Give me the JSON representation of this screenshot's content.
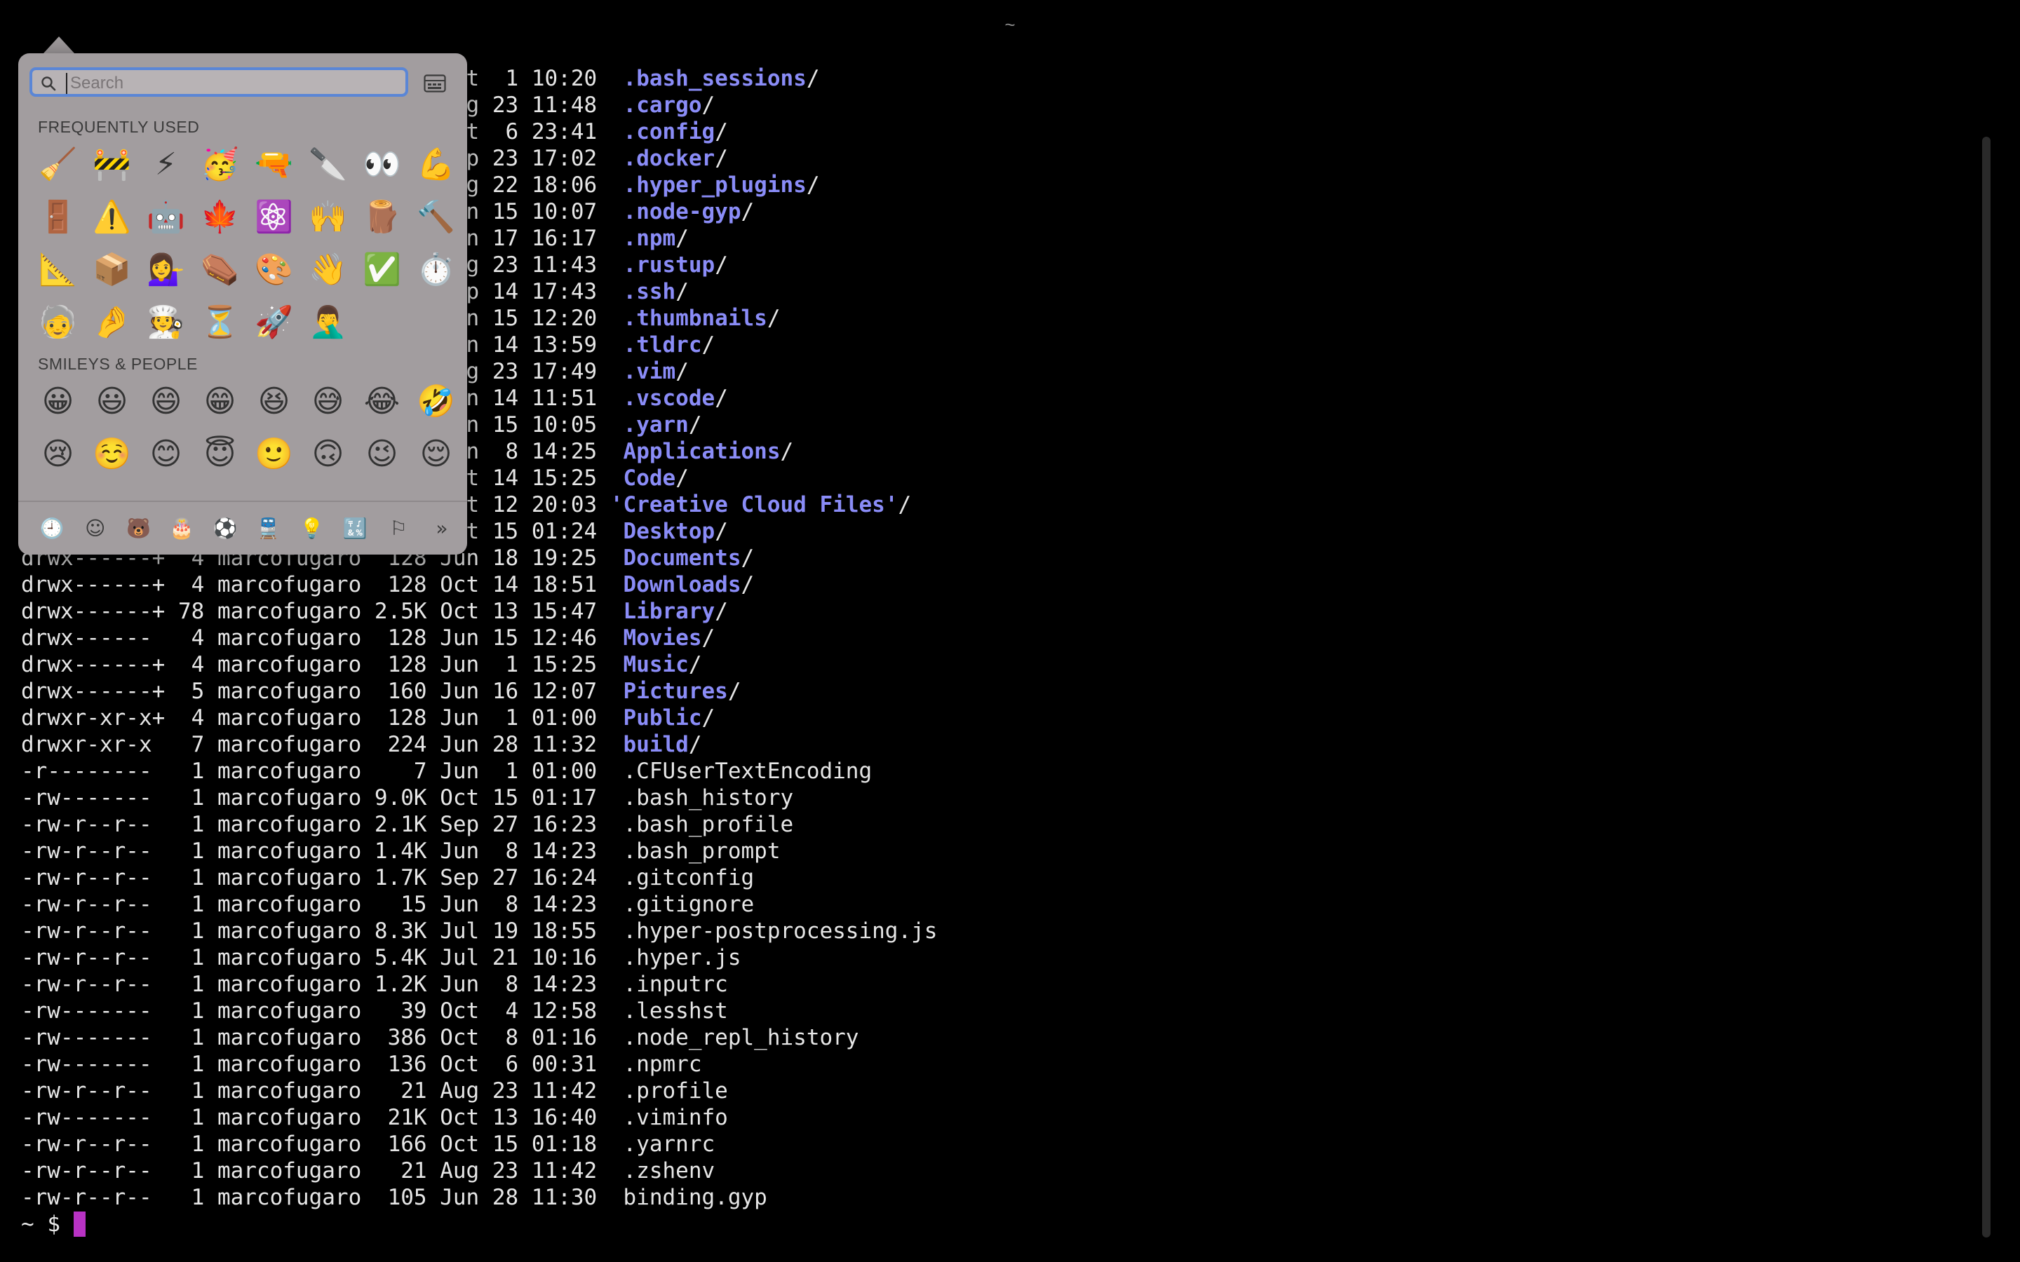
{
  "window": {
    "title": "~"
  },
  "terminal": {
    "lines": [
      [
        {
          "t": "drwx------+  4 marcofugaro  128 Oct  1 10:20  ",
          "c": "plain"
        },
        {
          "t": ".bash_sessions",
          "c": "dir"
        },
        {
          "t": "/",
          "c": "plain"
        }
      ],
      [
        {
          "t": "drwxr-xr-x   7 marcofugaro  224 Aug 23 11:48  ",
          "c": "plain"
        },
        {
          "t": ".cargo",
          "c": "dir"
        },
        {
          "t": "/",
          "c": "plain"
        }
      ],
      [
        {
          "t": "drwxr-xr-x   7 marcofugaro  224 Oct  6 23:41  ",
          "c": "plain"
        },
        {
          "t": ".config",
          "c": "dir"
        },
        {
          "t": "/",
          "c": "plain"
        }
      ],
      [
        {
          "t": "drwxr-xr-x   7 marcofugaro  224 Sep 23 17:02  ",
          "c": "plain"
        },
        {
          "t": ".docker",
          "c": "dir"
        },
        {
          "t": "/",
          "c": "plain"
        }
      ],
      [
        {
          "t": "drwxr-xr-x   7 marcofugaro  224 Aug 22 18:06  ",
          "c": "plain"
        },
        {
          "t": ".hyper_plugins",
          "c": "dir"
        },
        {
          "t": "/",
          "c": "plain"
        }
      ],
      [
        {
          "t": "drwxr-xr-x   7 marcofugaro  224 Jun 15 10:07  ",
          "c": "plain"
        },
        {
          "t": ".node-gyp",
          "c": "dir"
        },
        {
          "t": "/",
          "c": "plain"
        }
      ],
      [
        {
          "t": "drwxr-xr-x   7 marcofugaro  224 Jun 17 16:17  ",
          "c": "plain"
        },
        {
          "t": ".npm",
          "c": "dir"
        },
        {
          "t": "/",
          "c": "plain"
        }
      ],
      [
        {
          "t": "drwxr-xr-x   7 marcofugaro  224 Aug 23 11:43  ",
          "c": "plain"
        },
        {
          "t": ".rustup",
          "c": "dir"
        },
        {
          "t": "/",
          "c": "plain"
        }
      ],
      [
        {
          "t": "drwxr-xr-x   7 marcofugaro  224 Sep 14 17:43  ",
          "c": "plain"
        },
        {
          "t": ".ssh",
          "c": "dir"
        },
        {
          "t": "/",
          "c": "plain"
        }
      ],
      [
        {
          "t": "drwxr-xr-x   7 marcofugaro  224 Jun 15 12:20  ",
          "c": "plain"
        },
        {
          "t": ".thumbnails",
          "c": "dir"
        },
        {
          "t": "/",
          "c": "plain"
        }
      ],
      [
        {
          "t": "drwxr-xr-x   7 marcofugaro  224 Jun 14 13:59  ",
          "c": "plain"
        },
        {
          "t": ".tldrc",
          "c": "dir"
        },
        {
          "t": "/",
          "c": "plain"
        }
      ],
      [
        {
          "t": "drwxr-xr-x   7 marcofugaro  224 Aug 23 17:49  ",
          "c": "plain"
        },
        {
          "t": ".vim",
          "c": "dir"
        },
        {
          "t": "/",
          "c": "plain"
        }
      ],
      [
        {
          "t": "drwxr-xr-x   7 marcofugaro  224 Jun 14 11:51  ",
          "c": "plain"
        },
        {
          "t": ".vscode",
          "c": "dir"
        },
        {
          "t": "/",
          "c": "plain"
        }
      ],
      [
        {
          "t": "drwxr-xr-x   7 marcofugaro  224 Jun 15 10:05  ",
          "c": "plain"
        },
        {
          "t": ".yarn",
          "c": "dir"
        },
        {
          "t": "/",
          "c": "plain"
        }
      ],
      [
        {
          "t": "drwxr-xr-x   7 marcofugaro  224 Jun  8 14:25  ",
          "c": "plain"
        },
        {
          "t": "Applications",
          "c": "dir"
        },
        {
          "t": "/",
          "c": "plain"
        }
      ],
      [
        {
          "t": "drwxr-xr-x   7 marcofugaro  224 Oct 14 15:25  ",
          "c": "plain"
        },
        {
          "t": "Code",
          "c": "dir"
        },
        {
          "t": "/",
          "c": "plain"
        }
      ],
      [
        {
          "t": "drwxr-xr-x   7 marcofugaro  224 Oct 12 20:03 ",
          "c": "plain"
        },
        {
          "t": "'Creative Cloud Files'",
          "c": "dir"
        },
        {
          "t": "/",
          "c": "plain"
        }
      ],
      [
        {
          "t": "drwxr-xr-x   7 marcofugaro  224 Oct 15 01:24  ",
          "c": "plain"
        },
        {
          "t": "Desktop",
          "c": "dir"
        },
        {
          "t": "/",
          "c": "plain"
        }
      ],
      [
        {
          "t": "drwx------+  4 marcofugaro  128 Jun 18 19:25  ",
          "c": "plain"
        },
        {
          "t": "Documents",
          "c": "dir"
        },
        {
          "t": "/",
          "c": "plain"
        }
      ],
      [
        {
          "t": "drwx------+  4 marcofugaro  128 Oct 14 18:51  ",
          "c": "plain"
        },
        {
          "t": "Downloads",
          "c": "dir"
        },
        {
          "t": "/",
          "c": "plain"
        }
      ],
      [
        {
          "t": "drwx------+ 78 marcofugaro 2.5K Oct 13 15:47  ",
          "c": "plain"
        },
        {
          "t": "Library",
          "c": "dir"
        },
        {
          "t": "/",
          "c": "plain"
        }
      ],
      [
        {
          "t": "drwx------   4 marcofugaro  128 Jun 15 12:46  ",
          "c": "plain"
        },
        {
          "t": "Movies",
          "c": "dir"
        },
        {
          "t": "/",
          "c": "plain"
        }
      ],
      [
        {
          "t": "drwx------+  4 marcofugaro  128 Jun  1 15:25  ",
          "c": "plain"
        },
        {
          "t": "Music",
          "c": "dir"
        },
        {
          "t": "/",
          "c": "plain"
        }
      ],
      [
        {
          "t": "drwx------+  5 marcofugaro  160 Jun 16 12:07  ",
          "c": "plain"
        },
        {
          "t": "Pictures",
          "c": "dir"
        },
        {
          "t": "/",
          "c": "plain"
        }
      ],
      [
        {
          "t": "drwxr-xr-x+  4 marcofugaro  128 Jun  1 01:00  ",
          "c": "plain"
        },
        {
          "t": "Public",
          "c": "dir"
        },
        {
          "t": "/",
          "c": "plain"
        }
      ],
      [
        {
          "t": "drwxr-xr-x   7 marcofugaro  224 Jun 28 11:32  ",
          "c": "plain"
        },
        {
          "t": "build",
          "c": "dir"
        },
        {
          "t": "/",
          "c": "plain"
        }
      ],
      [
        {
          "t": "-r--------   1 marcofugaro    7 Jun  1 01:00  .CFUserTextEncoding",
          "c": "plain"
        }
      ],
      [
        {
          "t": "-rw-------   1 marcofugaro 9.0K Oct 15 01:17  .bash_history",
          "c": "plain"
        }
      ],
      [
        {
          "t": "-rw-r--r--   1 marcofugaro 2.1K Sep 27 16:23  .bash_profile",
          "c": "plain"
        }
      ],
      [
        {
          "t": "-rw-r--r--   1 marcofugaro 1.4K Jun  8 14:23  .bash_prompt",
          "c": "plain"
        }
      ],
      [
        {
          "t": "-rw-r--r--   1 marcofugaro 1.7K Sep 27 16:24  .gitconfig",
          "c": "plain"
        }
      ],
      [
        {
          "t": "-rw-r--r--   1 marcofugaro   15 Jun  8 14:23  .gitignore",
          "c": "plain"
        }
      ],
      [
        {
          "t": "-rw-r--r--   1 marcofugaro 8.3K Jul 19 18:55  .hyper-postprocessing.js",
          "c": "plain"
        }
      ],
      [
        {
          "t": "-rw-r--r--   1 marcofugaro 5.4K Jul 21 10:16  .hyper.js",
          "c": "plain"
        }
      ],
      [
        {
          "t": "-rw-r--r--   1 marcofugaro 1.2K Jun  8 14:23  .inputrc",
          "c": "plain"
        }
      ],
      [
        {
          "t": "-rw-------   1 marcofugaro   39 Oct  4 12:58  .lesshst",
          "c": "plain"
        }
      ],
      [
        {
          "t": "-rw-------   1 marcofugaro  386 Oct  8 01:16  .node_repl_history",
          "c": "plain"
        }
      ],
      [
        {
          "t": "-rw-------   1 marcofugaro  136 Oct  6 00:31  .npmrc",
          "c": "plain"
        }
      ],
      [
        {
          "t": "-rw-r--r--   1 marcofugaro   21 Aug 23 11:42  .profile",
          "c": "plain"
        }
      ],
      [
        {
          "t": "-rw-------   1 marcofugaro  21K Oct 13 16:40  .viminfo",
          "c": "plain"
        }
      ],
      [
        {
          "t": "-rw-r--r--   1 marcofugaro  166 Oct 15 01:18  .yarnrc",
          "c": "plain"
        }
      ],
      [
        {
          "t": "-rw-r--r--   1 marcofugaro   21 Aug 23 11:42  .zshenv",
          "c": "plain"
        }
      ],
      [
        {
          "t": "-rw-r--r--   1 marcofugaro  105 Jun 28 11:30  binding.gyp",
          "c": "plain"
        }
      ]
    ],
    "prompt": "~ $ ",
    "cursor_color": "#b832c4",
    "dir_color": "#8a8cf7"
  },
  "emoji_picker": {
    "search": {
      "placeholder": "Search",
      "value": ""
    },
    "search_icon": "search-icon",
    "palette_icon": "character-viewer-icon",
    "frequently_used": {
      "title": "FREQUENTLY USED",
      "emojis": [
        "🧹",
        "🚧",
        "⚡",
        "🥳",
        "🔫",
        "🔪",
        "👀",
        "💪",
        "🚪",
        "⚠️",
        "🤖",
        "🍁",
        "⚛️",
        "🙌",
        "🪵",
        "🔨",
        "📐",
        "📦",
        "💁‍♀️",
        "⚰️",
        "🎨",
        "👋",
        "✅",
        "⏱️",
        "🧓",
        "🤌",
        "🧑‍🍳",
        "⏳",
        "🚀",
        "🤦‍♂️"
      ]
    },
    "smileys_people": {
      "title": "SMILEYS & PEOPLE",
      "emojis": [
        "😀",
        "😃",
        "😄",
        "😁",
        "😆",
        "😅",
        "😂",
        "🤣",
        "😢",
        "☺️",
        "😊",
        "😇",
        "🙂",
        "🙃",
        "😉",
        "😌"
      ]
    },
    "categories": [
      {
        "name": "frequently-used",
        "glyph": "🕘"
      },
      {
        "name": "smileys-people",
        "glyph": "☺"
      },
      {
        "name": "animals-nature",
        "glyph": "🐻"
      },
      {
        "name": "food-drink",
        "glyph": "🎂"
      },
      {
        "name": "activity",
        "glyph": "⚽"
      },
      {
        "name": "travel-places",
        "glyph": "🚆"
      },
      {
        "name": "objects",
        "glyph": "💡"
      },
      {
        "name": "symbols",
        "glyph": "🔣"
      },
      {
        "name": "flags",
        "glyph": "⚐"
      },
      {
        "name": "more",
        "glyph": "»"
      }
    ],
    "active_category": "frequently-used"
  }
}
